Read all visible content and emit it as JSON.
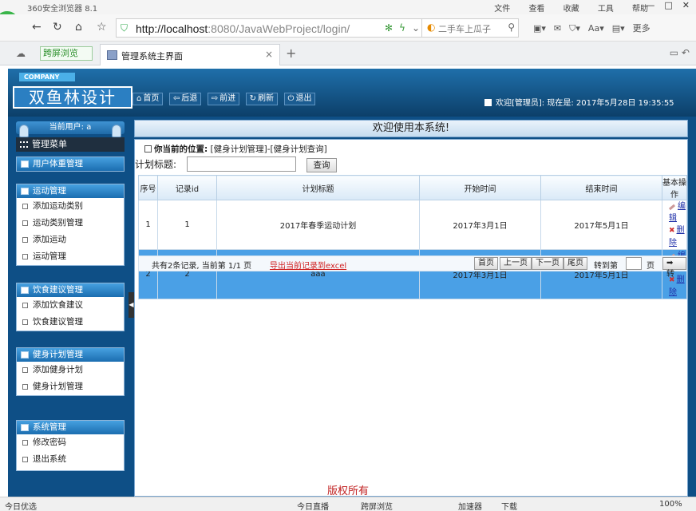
{
  "browser": {
    "app_name": "360安全浏览器 8.1",
    "menus": [
      "文件",
      "查看",
      "收藏",
      "工具",
      "帮助"
    ],
    "url_host": "http://localhost",
    "url_rest": ":8080/JavaWebProject/login/",
    "search_placeholder": "二手车上瓜子",
    "more_label": "更多",
    "split_view": "跨屏浏览",
    "tab_title": "管理系统主界面",
    "status_left": "今日优选",
    "status_live": "今日直播",
    "status_split": "跨屏浏览",
    "status_accel": "加速器",
    "status_download": "下载",
    "zoom": "100%"
  },
  "header": {
    "company": "COMPANY",
    "brand": "双鱼林设计",
    "nav": [
      {
        "icon": "home-icon",
        "glyph": "⌂",
        "label": "首页"
      },
      {
        "icon": "back-icon",
        "glyph": "⇦",
        "label": "后退"
      },
      {
        "icon": "forward-icon",
        "glyph": "⇨",
        "label": "前进"
      },
      {
        "icon": "refresh-icon",
        "glyph": "↻",
        "label": "刷新"
      },
      {
        "icon": "logout-icon",
        "glyph": "⏻",
        "label": "退出"
      }
    ],
    "welcome": "欢迎[管理员]: ",
    "now_label": "现在是: ",
    "datetime": "2017年5月28日 19:35:55",
    "banner": "欢迎使用本系统!"
  },
  "sidebar": {
    "current_user": "当前用户: a",
    "menu_title": "管理菜单",
    "groups": [
      {
        "title": "用户体重管理",
        "items": []
      },
      {
        "title": "运动管理",
        "items": [
          "添加运动类别",
          "运动类别管理",
          "添加运动",
          "运动管理"
        ]
      },
      {
        "title": "饮食建议管理",
        "items": [
          "添加饮食建议",
          "饮食建议管理"
        ]
      },
      {
        "title": "健身计划管理",
        "items": [
          "添加健身计划",
          "健身计划管理"
        ]
      },
      {
        "title": "系统管理",
        "items": [
          "修改密码",
          "退出系统"
        ]
      }
    ]
  },
  "content": {
    "location_label": "你当前的位置:",
    "location_path": "[健身计划管理]-[健身计划查询]",
    "search_label": "计划标题:",
    "search_value": "",
    "query_button": "查询",
    "columns": [
      "序号",
      "记录id",
      "计划标题",
      "开始时间",
      "结束时间",
      "基本操作"
    ],
    "rows": [
      {
        "no": "1",
        "id": "1",
        "title": "2017年春季运动计划",
        "start": "2017年3月1日",
        "end": "2017年5月1日",
        "edit": "编辑",
        "del": "删除"
      },
      {
        "no": "2",
        "id": "2",
        "title": "aaa",
        "start": "2017年3月1日",
        "end": "2017年5月1日",
        "edit": "编辑",
        "del": "删除"
      }
    ],
    "pager_info": "共有2条记录, 当前第 1/1 页",
    "export_label": "导出当前记录到excel",
    "first": "首页",
    "prev": "上一页",
    "next": "下一页",
    "last": "尾页",
    "goto_label": "转到第",
    "page_label": "页",
    "go_button": "➡ 转"
  },
  "copyright": "版权所有"
}
